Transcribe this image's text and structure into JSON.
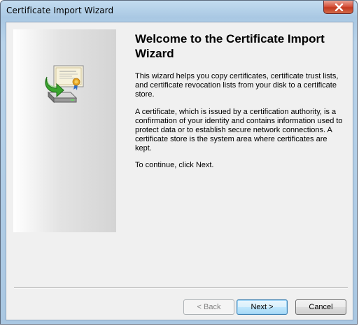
{
  "window": {
    "title": "Certificate Import Wizard",
    "close_icon": "close-icon"
  },
  "side_panel": {
    "icon": "certificate-import-icon"
  },
  "main": {
    "heading": "Welcome to the Certificate Import Wizard",
    "paragraphs": [
      "This wizard helps you copy certificates, certificate trust lists, and certificate revocation lists from your disk to a certificate store.",
      "A certificate, which is issued by a certification authority, is a confirmation of your identity and contains information used to protect data or to establish secure network connections. A certificate store is the system area where certificates are kept.",
      "To continue, click Next."
    ]
  },
  "buttons": {
    "back_label": "< Back",
    "next_label": "Next >",
    "cancel_label": "Cancel"
  },
  "colors": {
    "titlebar": "#b8d3ea",
    "client_background": "#f0f0f0",
    "close_button": "#c3391f",
    "default_button_border": "#3c7fb1"
  }
}
